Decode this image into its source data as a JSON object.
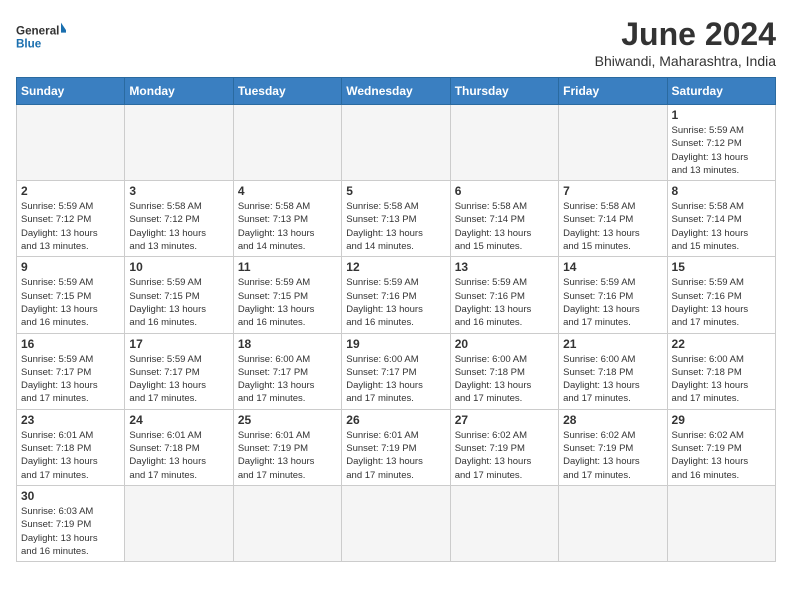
{
  "header": {
    "logo_general": "General",
    "logo_blue": "Blue",
    "month_year": "June 2024",
    "location": "Bhiwandi, Maharashtra, India"
  },
  "weekdays": [
    "Sunday",
    "Monday",
    "Tuesday",
    "Wednesday",
    "Thursday",
    "Friday",
    "Saturday"
  ],
  "weeks": [
    [
      {
        "day": "",
        "info": ""
      },
      {
        "day": "",
        "info": ""
      },
      {
        "day": "",
        "info": ""
      },
      {
        "day": "",
        "info": ""
      },
      {
        "day": "",
        "info": ""
      },
      {
        "day": "",
        "info": ""
      },
      {
        "day": "1",
        "info": "Sunrise: 5:59 AM\nSunset: 7:12 PM\nDaylight: 13 hours\nand 13 minutes."
      }
    ],
    [
      {
        "day": "2",
        "info": "Sunrise: 5:59 AM\nSunset: 7:12 PM\nDaylight: 13 hours\nand 13 minutes."
      },
      {
        "day": "3",
        "info": "Sunrise: 5:58 AM\nSunset: 7:12 PM\nDaylight: 13 hours\nand 13 minutes."
      },
      {
        "day": "4",
        "info": "Sunrise: 5:58 AM\nSunset: 7:13 PM\nDaylight: 13 hours\nand 14 minutes."
      },
      {
        "day": "5",
        "info": "Sunrise: 5:58 AM\nSunset: 7:13 PM\nDaylight: 13 hours\nand 14 minutes."
      },
      {
        "day": "6",
        "info": "Sunrise: 5:58 AM\nSunset: 7:14 PM\nDaylight: 13 hours\nand 15 minutes."
      },
      {
        "day": "7",
        "info": "Sunrise: 5:58 AM\nSunset: 7:14 PM\nDaylight: 13 hours\nand 15 minutes."
      },
      {
        "day": "8",
        "info": "Sunrise: 5:58 AM\nSunset: 7:14 PM\nDaylight: 13 hours\nand 15 minutes."
      }
    ],
    [
      {
        "day": "9",
        "info": "Sunrise: 5:59 AM\nSunset: 7:15 PM\nDaylight: 13 hours\nand 16 minutes."
      },
      {
        "day": "10",
        "info": "Sunrise: 5:59 AM\nSunset: 7:15 PM\nDaylight: 13 hours\nand 16 minutes."
      },
      {
        "day": "11",
        "info": "Sunrise: 5:59 AM\nSunset: 7:15 PM\nDaylight: 13 hours\nand 16 minutes."
      },
      {
        "day": "12",
        "info": "Sunrise: 5:59 AM\nSunset: 7:16 PM\nDaylight: 13 hours\nand 16 minutes."
      },
      {
        "day": "13",
        "info": "Sunrise: 5:59 AM\nSunset: 7:16 PM\nDaylight: 13 hours\nand 16 minutes."
      },
      {
        "day": "14",
        "info": "Sunrise: 5:59 AM\nSunset: 7:16 PM\nDaylight: 13 hours\nand 17 minutes."
      },
      {
        "day": "15",
        "info": "Sunrise: 5:59 AM\nSunset: 7:16 PM\nDaylight: 13 hours\nand 17 minutes."
      }
    ],
    [
      {
        "day": "16",
        "info": "Sunrise: 5:59 AM\nSunset: 7:17 PM\nDaylight: 13 hours\nand 17 minutes."
      },
      {
        "day": "17",
        "info": "Sunrise: 5:59 AM\nSunset: 7:17 PM\nDaylight: 13 hours\nand 17 minutes."
      },
      {
        "day": "18",
        "info": "Sunrise: 6:00 AM\nSunset: 7:17 PM\nDaylight: 13 hours\nand 17 minutes."
      },
      {
        "day": "19",
        "info": "Sunrise: 6:00 AM\nSunset: 7:17 PM\nDaylight: 13 hours\nand 17 minutes."
      },
      {
        "day": "20",
        "info": "Sunrise: 6:00 AM\nSunset: 7:18 PM\nDaylight: 13 hours\nand 17 minutes."
      },
      {
        "day": "21",
        "info": "Sunrise: 6:00 AM\nSunset: 7:18 PM\nDaylight: 13 hours\nand 17 minutes."
      },
      {
        "day": "22",
        "info": "Sunrise: 6:00 AM\nSunset: 7:18 PM\nDaylight: 13 hours\nand 17 minutes."
      }
    ],
    [
      {
        "day": "23",
        "info": "Sunrise: 6:01 AM\nSunset: 7:18 PM\nDaylight: 13 hours\nand 17 minutes."
      },
      {
        "day": "24",
        "info": "Sunrise: 6:01 AM\nSunset: 7:18 PM\nDaylight: 13 hours\nand 17 minutes."
      },
      {
        "day": "25",
        "info": "Sunrise: 6:01 AM\nSunset: 7:19 PM\nDaylight: 13 hours\nand 17 minutes."
      },
      {
        "day": "26",
        "info": "Sunrise: 6:01 AM\nSunset: 7:19 PM\nDaylight: 13 hours\nand 17 minutes."
      },
      {
        "day": "27",
        "info": "Sunrise: 6:02 AM\nSunset: 7:19 PM\nDaylight: 13 hours\nand 17 minutes."
      },
      {
        "day": "28",
        "info": "Sunrise: 6:02 AM\nSunset: 7:19 PM\nDaylight: 13 hours\nand 17 minutes."
      },
      {
        "day": "29",
        "info": "Sunrise: 6:02 AM\nSunset: 7:19 PM\nDaylight: 13 hours\nand 16 minutes."
      }
    ],
    [
      {
        "day": "30",
        "info": "Sunrise: 6:03 AM\nSunset: 7:19 PM\nDaylight: 13 hours\nand 16 minutes."
      },
      {
        "day": "",
        "info": ""
      },
      {
        "day": "",
        "info": ""
      },
      {
        "day": "",
        "info": ""
      },
      {
        "day": "",
        "info": ""
      },
      {
        "day": "",
        "info": ""
      },
      {
        "day": "",
        "info": ""
      }
    ]
  ]
}
